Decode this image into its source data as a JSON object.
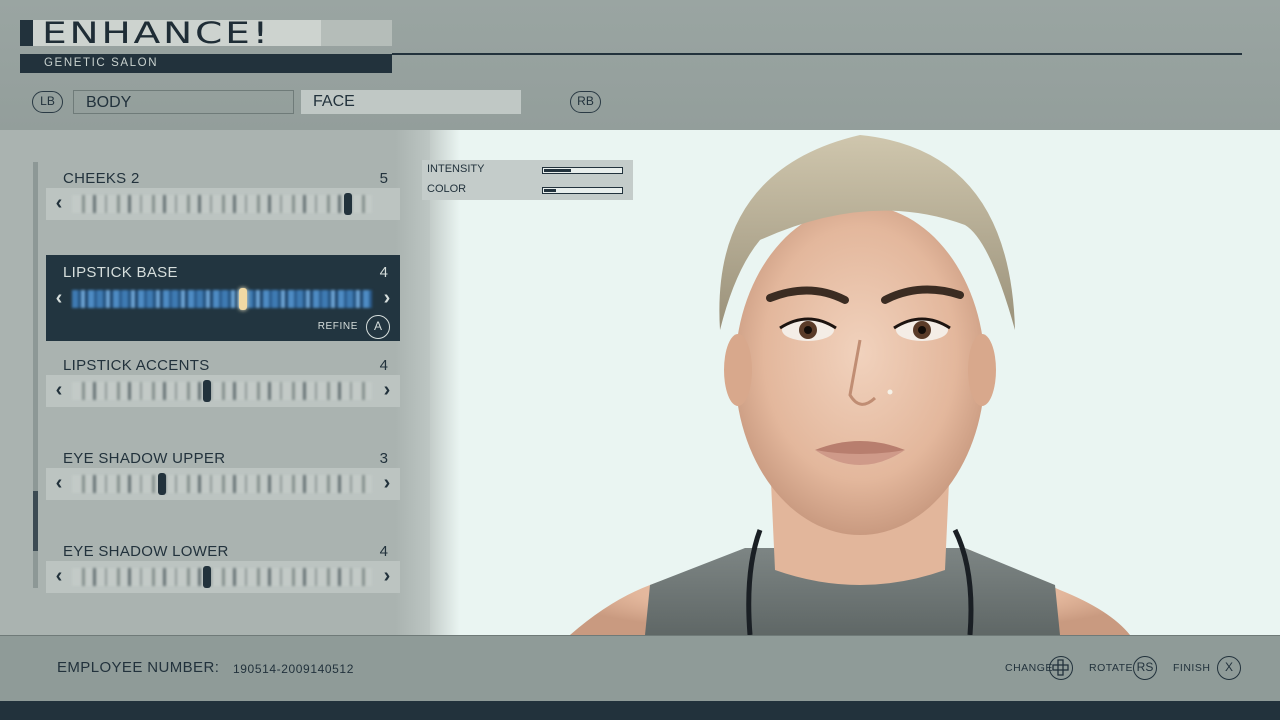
{
  "header": {
    "title": "ENHANCE!",
    "subtitle": "GENETIC SALON",
    "lb_label": "LB",
    "rb_label": "RB",
    "tabs": [
      {
        "label": "BODY",
        "selected": false
      },
      {
        "label": "FACE",
        "selected": true
      }
    ]
  },
  "sliders": [
    {
      "label": "CHEEKS 2",
      "value": "5",
      "knob_fraction": 0.92,
      "selected": false
    },
    {
      "label": "LIPSTICK BASE",
      "value": "4",
      "knob_fraction": 0.57,
      "selected": true
    },
    {
      "label": "LIPSTICK ACCENTS",
      "value": "4",
      "knob_fraction": 0.45,
      "selected": false
    },
    {
      "label": "EYE SHADOW UPPER",
      "value": "3",
      "knob_fraction": 0.3,
      "selected": false
    },
    {
      "label": "EYE SHADOW LOWER",
      "value": "4",
      "knob_fraction": 0.45,
      "selected": false
    }
  ],
  "refine": {
    "label": "REFINE",
    "button": "A"
  },
  "arrows": {
    "left": "‹",
    "right": "›"
  },
  "intensity_panel": {
    "intensity_label": "INTENSITY",
    "intensity_level": 0.35,
    "color_label": "COLOR",
    "color_level": 0.15
  },
  "footer": {
    "employee_label": "EMPLOYEE NUMBER:",
    "employee_value": "190514-2009140512",
    "change_label": "CHANGE",
    "rotate_label": "ROTATE",
    "rotate_button": "RS",
    "finish_label": "FINISH",
    "finish_button": "X"
  },
  "colors": {
    "dark": "#22323c",
    "panel": "#aab3b0",
    "preview_bg": "#eaf5f2",
    "selected_row": "#223540"
  }
}
